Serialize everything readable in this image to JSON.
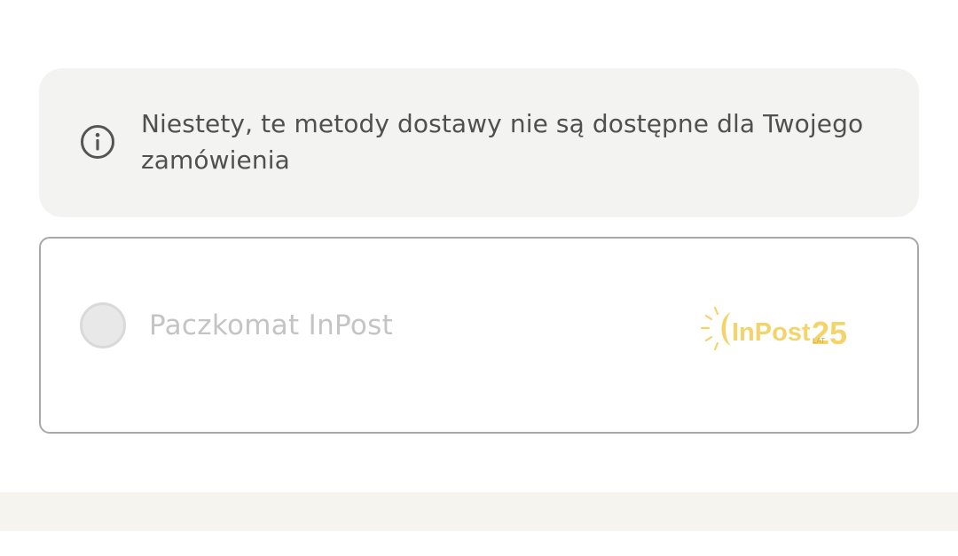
{
  "notice": {
    "icon": "info-icon",
    "message": "Niestety, te metody dostawy nie są dostępne dla Twojego zamówienia"
  },
  "delivery_options": [
    {
      "label": "Paczkomat InPost",
      "selected": false,
      "disabled": true,
      "logo": {
        "brand_text": "InPost",
        "badge_number": "25",
        "badge_text": "LAT"
      }
    }
  ],
  "colors": {
    "notice_bg": "#f3f4f2",
    "text": "#505050",
    "disabled_text": "#c4c4c4",
    "card_border": "#a8a8a8",
    "logo_yellow": "#f4d46a"
  }
}
